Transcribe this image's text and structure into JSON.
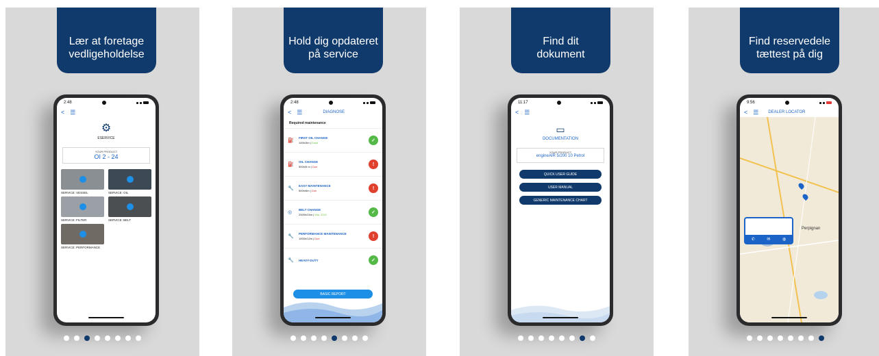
{
  "panels": [
    {
      "title_lines": [
        "Lær at foretage",
        "vedligeholdelse"
      ],
      "status_time": "2:48",
      "product_label": "YOUR PRODUCT",
      "product_value": "OI 2 - 24",
      "screen_title": "ESERVICE",
      "videos": [
        "SERVICE: VESSEL",
        "SERVICE: OIL",
        "SERVICE: FILTER",
        "SERVICE: BELT",
        "SERVICE: PERFORMANCE"
      ],
      "dots_active": 2
    },
    {
      "title_lines": [
        "Hold dig opdateret",
        "på service"
      ],
      "status_time": "2:48",
      "screen_title": "DIAGNOSE",
      "section": "Required maintenance",
      "items": [
        {
          "name": "FIRST OIL CHANGE",
          "interval": "100h/3m",
          "status": "Done",
          "state": "ok"
        },
        {
          "name": "OIL CHANGE",
          "interval": "500h/6 m",
          "status": "Due",
          "state": "warn"
        },
        {
          "name": "EASY MAINTENANCE",
          "interval": "500h/6m",
          "status": "Due",
          "state": "warn"
        },
        {
          "name": "BELT CHANGE",
          "interval": "2000h/24m",
          "status": "Mar. 2021",
          "state": "ok"
        },
        {
          "name": "PERFORMANCE MAINTENANCE",
          "interval": "1000h/12m",
          "status": "Due",
          "state": "warn"
        },
        {
          "name": "HEAVY-DUTY",
          "interval": "",
          "status": "",
          "state": "ok"
        }
      ],
      "button": "BASIC REPORT",
      "dots_active": 4
    },
    {
      "title_lines": [
        "Find dit",
        "dokument"
      ],
      "status_time": "11:17",
      "screen_title": "DOCUMENTATION",
      "product_label": "YOUR PRODUCT",
      "product_value": "engineAIR 5/200 10 Petrol",
      "buttons": [
        "QUICK USER GUIDE",
        "USER MANUAL",
        "GENERIC MAINTENANCE CHART"
      ],
      "dots_active": 6
    },
    {
      "title_lines": [
        "Find reservedele",
        "tættest på dig"
      ],
      "status_time": "9:56",
      "screen_title": "DEALER LOCATOR",
      "map_labels": [
        "Perpignan"
      ],
      "dots_active": 7
    }
  ],
  "dot_count": 8,
  "colors": {
    "navy": "#0f3a6b",
    "blue": "#1b63c6",
    "ok": "#55b948",
    "warn": "#e0412f"
  }
}
